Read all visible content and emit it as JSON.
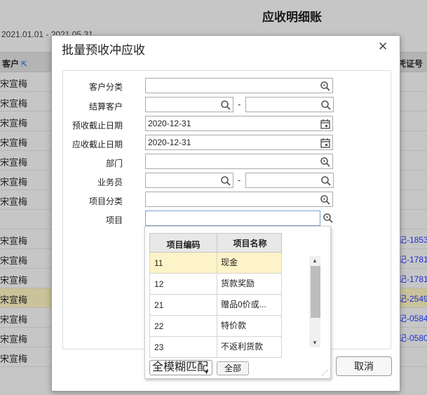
{
  "background": {
    "report_title": "应收明细账",
    "date_range": "2021.01.01 - 2021.05.31",
    "col_customer": "客户",
    "col_voucher": "凭证号",
    "rows": [
      {
        "customer": "宋宣梅",
        "voucher": ""
      },
      {
        "customer": "宋宣梅",
        "voucher": ""
      },
      {
        "customer": "宋宣梅",
        "voucher": ""
      },
      {
        "customer": "宋宣梅",
        "voucher": ""
      },
      {
        "customer": "宋宣梅",
        "voucher": ""
      },
      {
        "customer": "宋宣梅",
        "voucher": ""
      },
      {
        "customer": "宋宣梅",
        "voucher": ""
      },
      {
        "customer": "",
        "voucher": ""
      },
      {
        "customer": "宋宣梅",
        "voucher": "记-1853"
      },
      {
        "customer": "宋宣梅",
        "voucher": "记-1781"
      },
      {
        "customer": "宋宣梅",
        "voucher": "记-1781"
      },
      {
        "customer": "宋宣梅",
        "voucher": "记-2549"
      },
      {
        "customer": "宋宣梅",
        "voucher": "记-0584"
      },
      {
        "customer": "宋宣梅",
        "voucher": "记-0580"
      },
      {
        "customer": "宋宣梅",
        "voucher": ""
      }
    ],
    "highlighted_row": 11
  },
  "dialog": {
    "title": "批量预收冲应收",
    "close_label": "×",
    "fields": {
      "customer_category_label": "客户分类",
      "settle_customer_label": "结算客户",
      "range_sep": "-",
      "prepay_cutoff_label": "预收截止日期",
      "prepay_cutoff_value": "2020-12-31",
      "receivable_cutoff_label": "应收截止日期",
      "receivable_cutoff_value": "2020-12-31",
      "department_label": "部门",
      "salesperson_label": "业务员",
      "project_category_label": "项目分类",
      "project_label": "项目"
    },
    "cancel_label": "取消"
  },
  "dropdown": {
    "col_code": "项目编码",
    "col_name": "项目名称",
    "rows": [
      {
        "code": "11",
        "name": "现金"
      },
      {
        "code": "12",
        "name": "货款奖励"
      },
      {
        "code": "21",
        "name": "赠品0价或..."
      },
      {
        "code": "22",
        "name": "特价款"
      },
      {
        "code": "23",
        "name": "不返利货款"
      }
    ],
    "selected_row": 0,
    "match_mode": "全模糊匹配",
    "all_button": "全部"
  },
  "colors": {
    "voucher_link": "#1f2fd1",
    "highlight_row": "#c9c29a",
    "selected_option": "#fdf3c8"
  }
}
